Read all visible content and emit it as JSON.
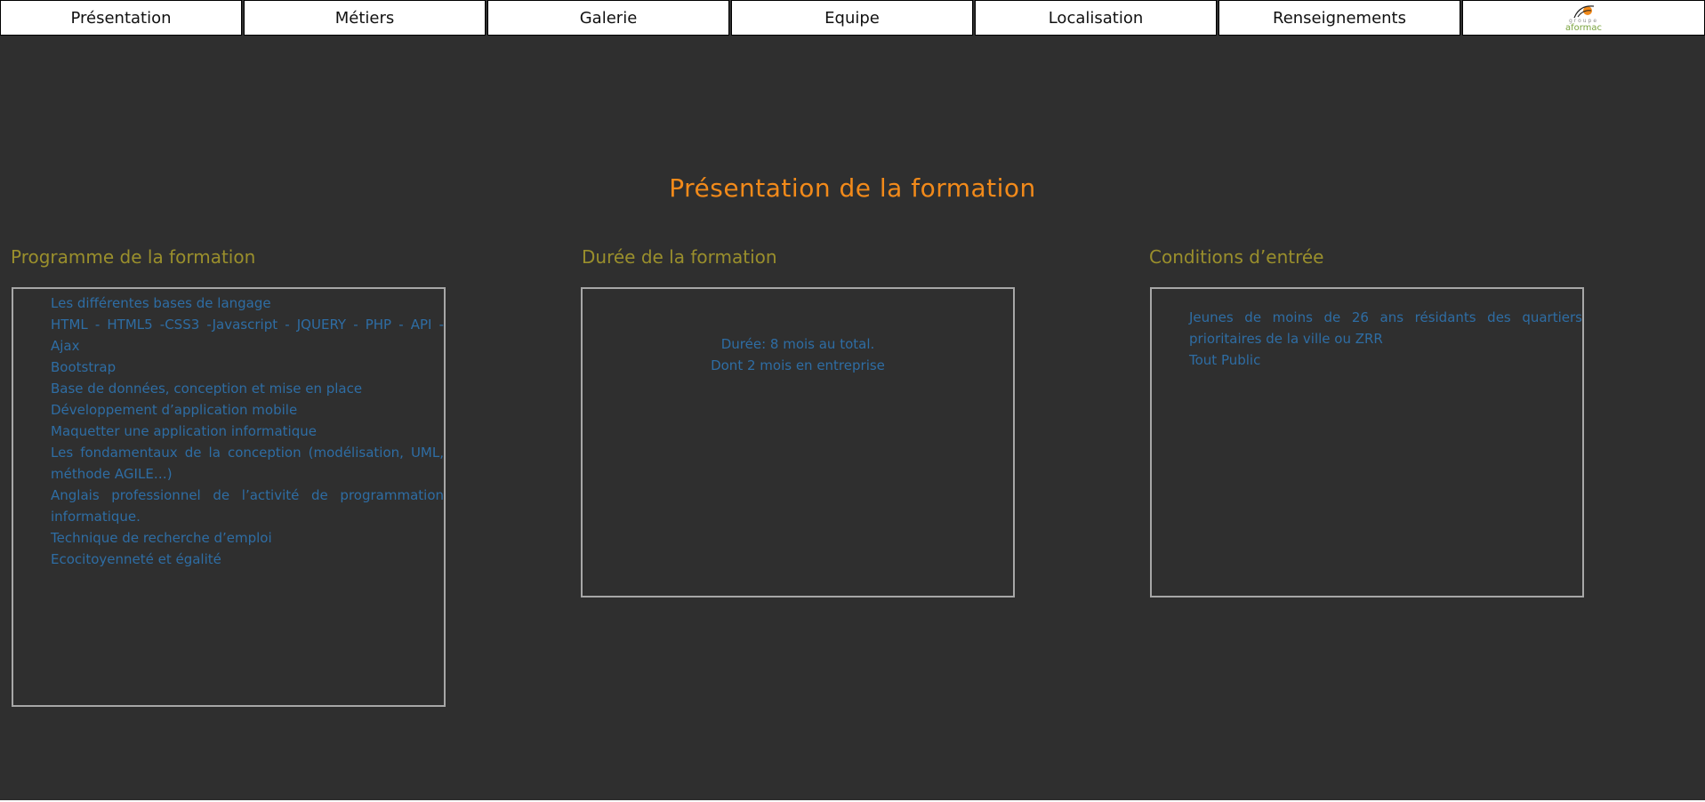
{
  "topnav": {
    "items": [
      {
        "label": "Présentation"
      },
      {
        "label": "Métiers"
      },
      {
        "label": "Galerie"
      },
      {
        "label": "Equipe"
      },
      {
        "label": "Localisation"
      },
      {
        "label": "Renseignements"
      }
    ],
    "logo": {
      "small_text": "groupe",
      "text": "aformac"
    }
  },
  "main": {
    "title": "Présentation de la formation",
    "program": {
      "title": "Programme de la formation",
      "items": [
        "Les différentes bases de langage",
        "HTML - HTML5 -CSS3 -Javascript - JQUERY - PHP - API - Ajax",
        "Bootstrap",
        "Base de données, conception et mise en place",
        "Développement d’application mobile",
        "Maquetter une application informatique",
        "Les fondamentaux de la conception (modélisation, UML, méthode AGILE…)",
        "Anglais professionnel de l’activité de programmation informatique.",
        "Technique de recherche d’emploi",
        "Ecocitoyenneté et égalité"
      ]
    },
    "duration": {
      "title": "Durée de la formation",
      "line1": "Durée: 8 mois au total.",
      "line2": "Dont 2 mois en entreprise"
    },
    "conditions": {
      "title": "Conditions d’entrée",
      "items": [
        "Jeunes de moins de 26 ans résidants des quartiers prioritaires de la ville ou ZRR",
        "Tout Public"
      ]
    }
  },
  "colors": {
    "background": "#2f2f2f",
    "title_orange": "#f28a1a",
    "section_olive": "#9a8f2c",
    "body_blue": "#2e6da4",
    "panel_border": "#a7a7a7"
  }
}
